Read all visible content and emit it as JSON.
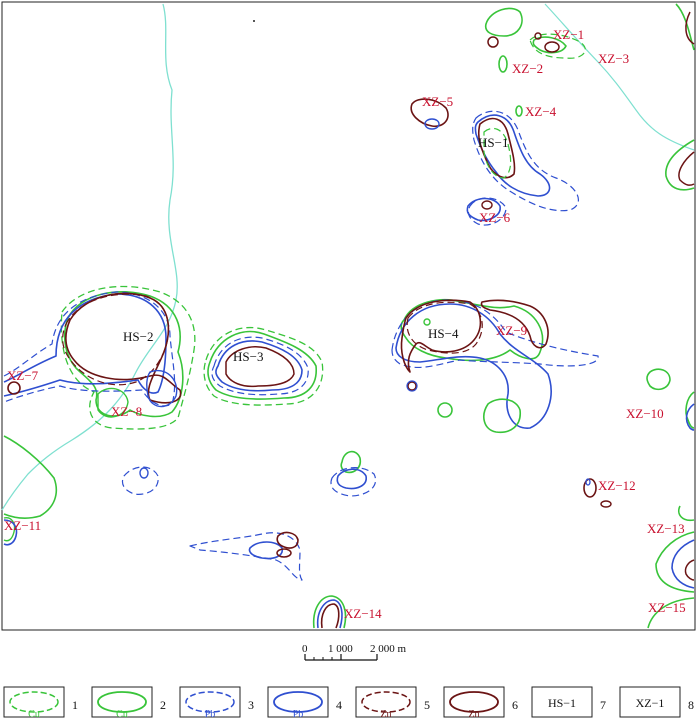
{
  "colors": {
    "cu": "#39c43a",
    "pb": "#2f4fd0",
    "zn": "#6b1414",
    "river": "#7fe0d0",
    "label_red": "#c8102e",
    "label_black": "#111111"
  },
  "map_labels": {
    "xz1": "XZ−1",
    "xz2": "XZ−2",
    "xz3": "XZ−3",
    "xz4": "XZ−4",
    "xz5": "XZ−5",
    "xz6": "XZ−6",
    "xz7": "XZ−7",
    "xz8": "XZ−8",
    "xz9": "XZ−9",
    "xz10": "XZ−10",
    "xz11": "XZ−11",
    "xz12": "XZ−12",
    "xz13": "XZ−13",
    "xz14": "XZ−14",
    "xz15": "XZ−15",
    "hs1": "HS−1",
    "hs2": "HS−2",
    "hs3": "HS−3",
    "hs4": "HS−4"
  },
  "scale_bar": {
    "t0": "0",
    "t1": "1 000",
    "t2": "2 000 m"
  },
  "legend": [
    {
      "inner": "Cu",
      "num": "1"
    },
    {
      "inner": "Cu",
      "num": "2"
    },
    {
      "inner": "Pb",
      "num": "3"
    },
    {
      "inner": "Pb",
      "num": "4"
    },
    {
      "inner": "Zn",
      "num": "5"
    },
    {
      "inner": "Zn",
      "num": "6"
    },
    {
      "inner": "HS−1",
      "num": "7"
    },
    {
      "inner": "XZ−1",
      "num": "8"
    }
  ]
}
